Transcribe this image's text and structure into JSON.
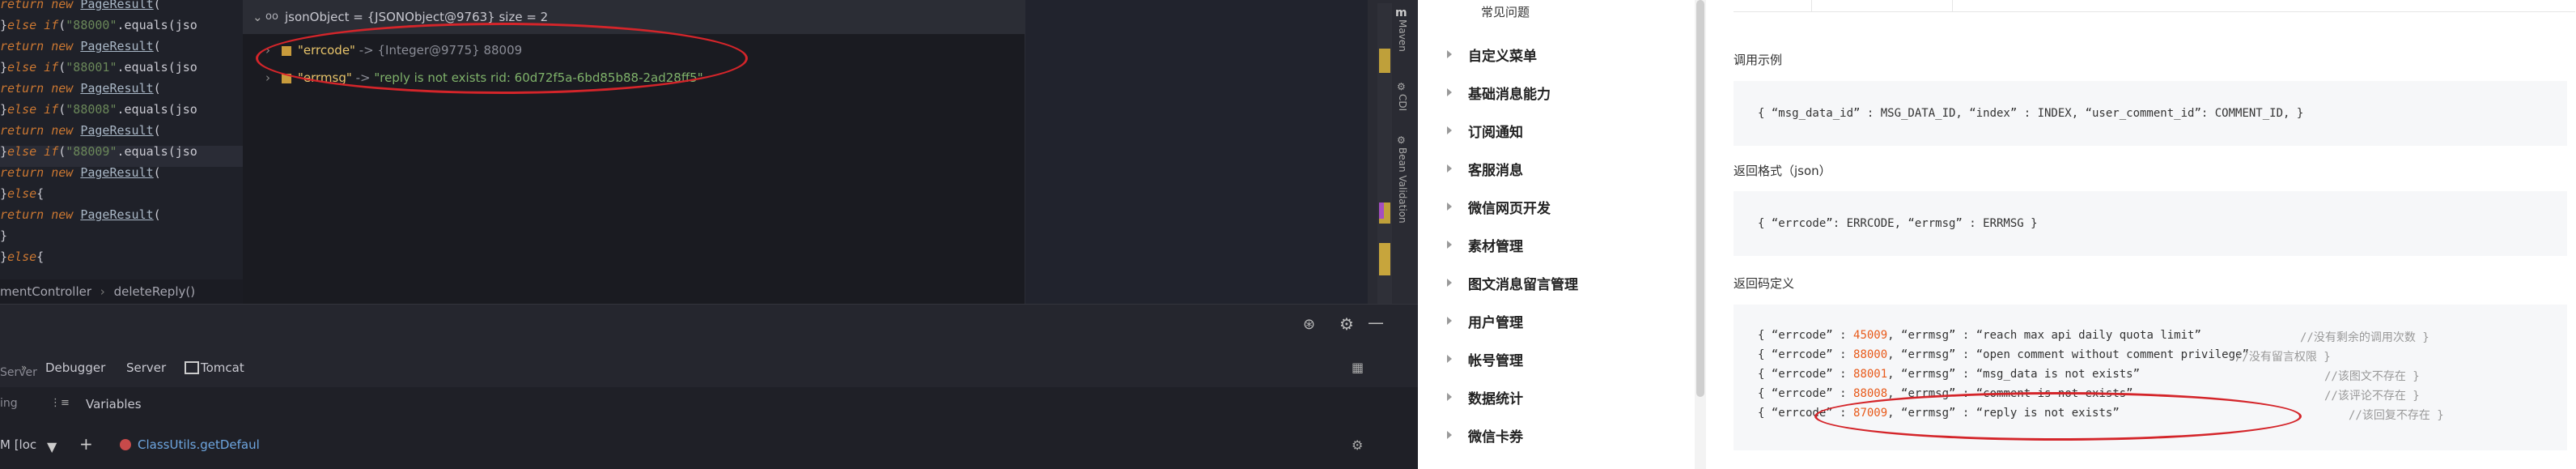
{
  "ide": {
    "code_lines": [
      {
        "pre": "      ",
        "kw": "return",
        "mid": "  ",
        "kw2": "new",
        "cls": "PageResult",
        "rest": "("
      },
      {
        "pre": "  }",
        "kw": "else if",
        "mid": "(",
        "str": "\"88000\"",
        "rest": ".equals(jso"
      },
      {
        "pre": "      ",
        "kw": "return",
        "mid": "  ",
        "kw2": "new",
        "cls": "PageResult",
        "rest": "("
      },
      {
        "pre": "  }",
        "kw": "else if",
        "mid": "(",
        "str": "\"88001\"",
        "rest": ".equals(jso"
      },
      {
        "pre": "      ",
        "kw": "return",
        "mid": "  ",
        "kw2": "new",
        "cls": "PageResult",
        "rest": "("
      },
      {
        "pre": "  }",
        "kw": "else if",
        "mid": "(",
        "str": "\"88008\"",
        "rest": ".equals(jso"
      },
      {
        "pre": "      ",
        "kw": "return",
        "mid": "  ",
        "kw2": "new",
        "cls": "PageResult",
        "rest": "("
      },
      {
        "pre": "  }",
        "kw": "else if",
        "mid": "(",
        "str": "\"88009\"",
        "rest": ".equals(jso"
      },
      {
        "pre": "      ",
        "kw": "return",
        "mid": "  ",
        "kw2": "new",
        "cls": "PageResult",
        "rest": "("
      },
      {
        "pre": "  }",
        "kw": "else",
        "mid": "{",
        "str": "",
        "rest": ""
      },
      {
        "pre": "      ",
        "kw": "return",
        "mid": "  ",
        "kw2": "new",
        "cls": "PageResult",
        "rest": "("
      },
      {
        "pre": "  }",
        "kw": "",
        "mid": "",
        "str": "",
        "rest": ""
      },
      {
        "pre": "}",
        "kw": "else",
        "mid": "{",
        "str": "",
        "rest": ""
      }
    ],
    "breadcrumb": [
      "mentController",
      "deleteReply()"
    ],
    "popup": {
      "header": "jsonObject = {JSONObject@9763}  size = 2",
      "rows": [
        {
          "name": "\"errcode\"",
          "arrow": " -> ",
          "value": "{Integer@9775} 88009"
        },
        {
          "name": "\"errmsg\"",
          "arrow": " -> ",
          "value": "\"reply is not exists rid: 60d72f5a-6bd85b88-2ad28ff5\""
        }
      ]
    },
    "side_labels": [
      "Maven",
      "CDI",
      "Bean Validation"
    ],
    "tabs": [
      "Debugger",
      "Server",
      "Tomcat"
    ],
    "tab_extras": [
      "Server",
      "ing"
    ],
    "variables_label": "Variables",
    "frame_text": "ClassUtils.getDefaul",
    "frame_prefix": "M [loc"
  },
  "doc": {
    "nav_top": "常见问题",
    "nav_items": [
      "自定义菜单",
      "基础消息能力",
      "订阅通知",
      "客服消息",
      "微信网页开发",
      "素材管理",
      "图文消息留言管理",
      "用户管理",
      "帐号管理",
      "数据统计",
      "微信卡券"
    ],
    "sections": {
      "call_example": "调用示例",
      "call_code": "{ “msg_data_id” : MSG_DATA_ID, “index”        : INDEX, “user_comment_id”: COMMENT_ID, }",
      "return_format": "返回格式（json）",
      "return_code": "{ “errcode”: ERRCODE, “errmsg” : ERRMSG }",
      "return_def": "返回码定义",
      "codes": [
        {
          "num": "45009",
          "msg": "“reach max api daily quota limit”",
          "cmt": "//没有剩余的调用次数 }"
        },
        {
          "num": "88000",
          "msg": "“open comment without comment privilege”",
          "cmt": "//没有留言权限 }"
        },
        {
          "num": "88001",
          "msg": "“msg_data is not exists”",
          "cmt": "//该图文不存在 }"
        },
        {
          "num": "88008",
          "msg": "“comment is not exists”",
          "cmt": "//该评论不存在 }"
        },
        {
          "num": "87009",
          "msg": "“reply is not exists”",
          "cmt": "//该回复不存在 }"
        }
      ]
    }
  }
}
